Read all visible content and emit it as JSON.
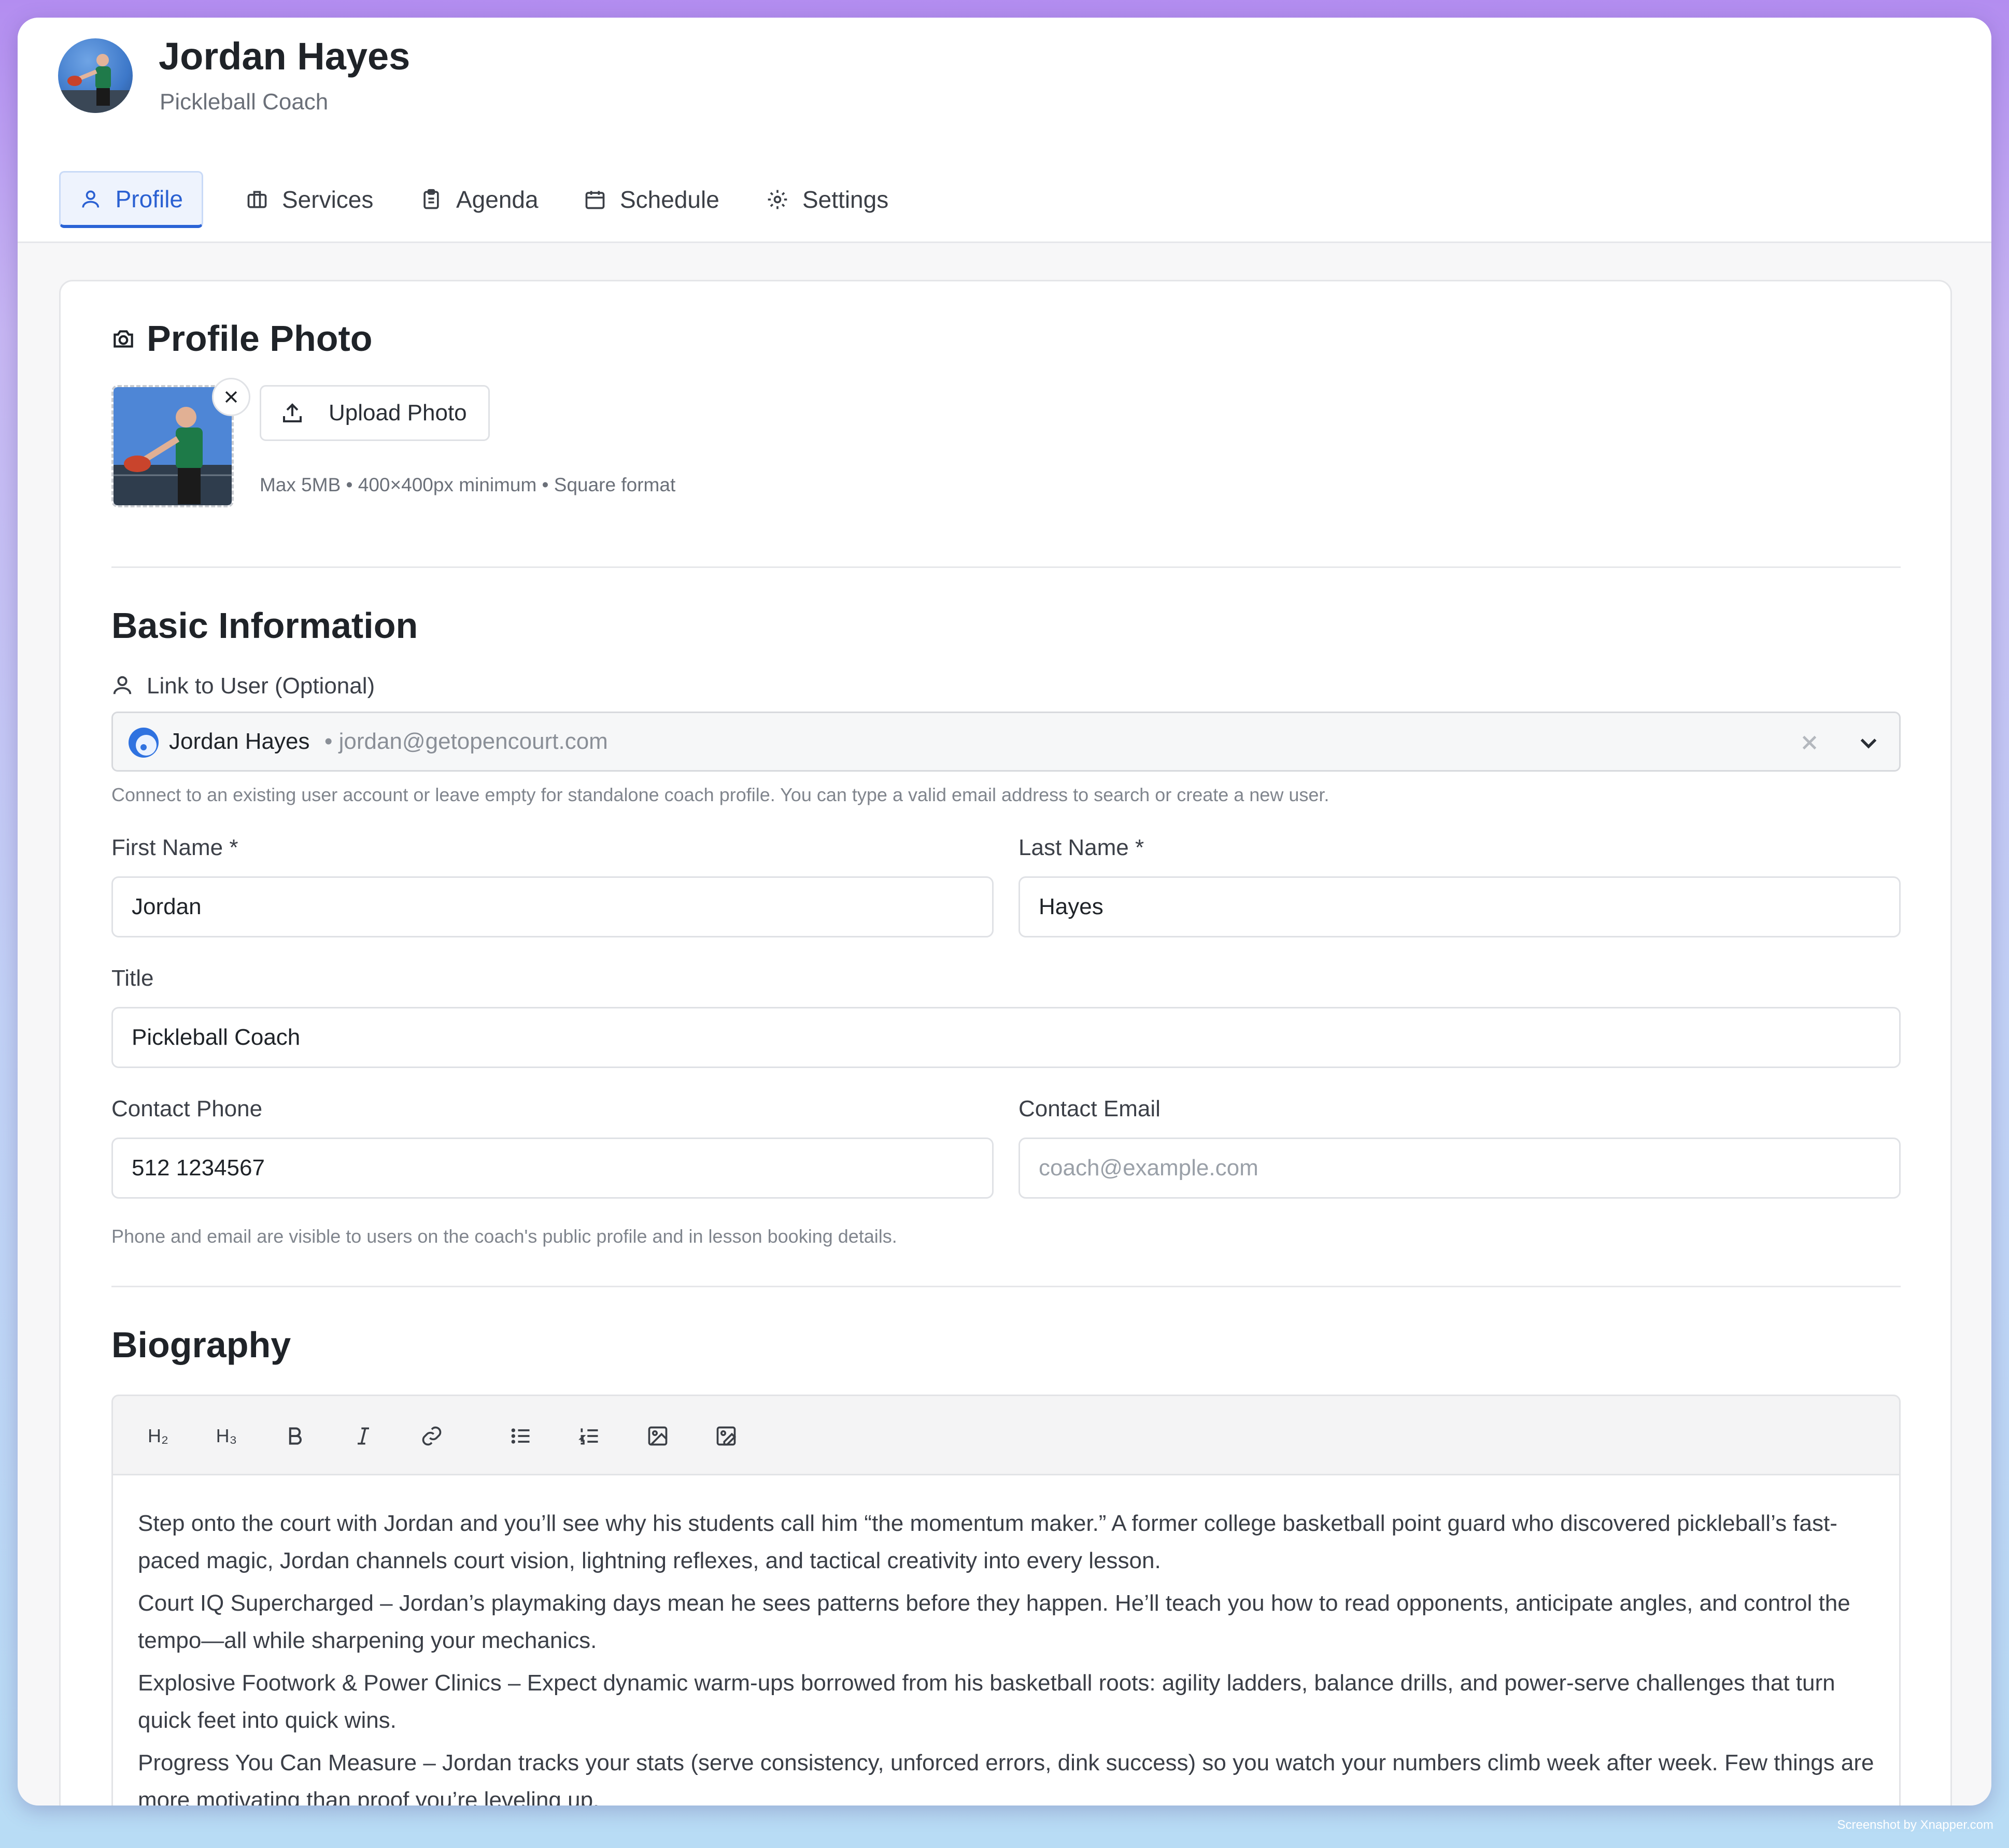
{
  "header": {
    "name": "Jordan Hayes",
    "subtitle": "Pickleball Coach"
  },
  "tabs": [
    {
      "label": "Profile",
      "icon": "user-icon",
      "active": true
    },
    {
      "label": "Services",
      "icon": "briefcase-icon"
    },
    {
      "label": "Agenda",
      "icon": "clipboard-icon"
    },
    {
      "label": "Schedule",
      "icon": "calendar-icon"
    },
    {
      "label": "Settings",
      "icon": "gear-icon"
    }
  ],
  "profile_photo": {
    "title": "Profile Photo",
    "upload_label": "Upload Photo",
    "hint": "Max 5MB • 400×400px minimum • Square format"
  },
  "basic": {
    "title": "Basic Information",
    "link_label": "Link to User (Optional)",
    "linked_name": "Jordan Hayes",
    "linked_email": "• jordan@getopencourt.com",
    "link_hint": "Connect to an existing user account or leave empty for standalone coach profile. You can type a valid email address to search or create a new user.",
    "first_name_label": "First Name *",
    "first_name_value": "Jordan",
    "last_name_label": "Last Name *",
    "last_name_value": "Hayes",
    "title_label": "Title",
    "title_value": "Pickleball Coach",
    "phone_label": "Contact Phone",
    "phone_value": "512 1234567",
    "email_label": "Contact Email",
    "email_placeholder": "coach@example.com",
    "contact_hint": "Phone and email are visible to users on the coach's public profile and in lesson booking details."
  },
  "biography": {
    "title": "Biography",
    "toolbar": {
      "h2": "H₂",
      "h3": "H₃"
    },
    "paragraphs": [
      "Step onto the court with Jordan and you’ll see why his students call him “the momentum maker.” A former college basketball point guard who discovered pickleball’s fast-paced magic, Jordan channels court vision, lightning reflexes, and tactical creativity into every lesson.",
      "Court IQ Supercharged – Jordan’s playmaking days mean he sees patterns before they happen. He’ll teach you how to read opponents, anticipate angles, and control the tempo—all while sharpening your mechanics.",
      "Explosive Footwork & Power Clinics – Expect dynamic warm-ups borrowed from his basketball roots: agility ladders, balance drills, and power-serve challenges that turn quick feet into quick wins.",
      "Progress You Can Measure – Jordan tracks your stats (serve consistency, unforced errors, dink success) so you watch your numbers climb week after week. Few things are more motivating than proof you’re leveling up."
    ]
  },
  "watermark": "Screenshot by Xnapper.com",
  "colors": {
    "accent": "#2a63d6",
    "background_gradient_top": "#b38df0",
    "background_gradient_bottom": "#b8dcf5"
  }
}
